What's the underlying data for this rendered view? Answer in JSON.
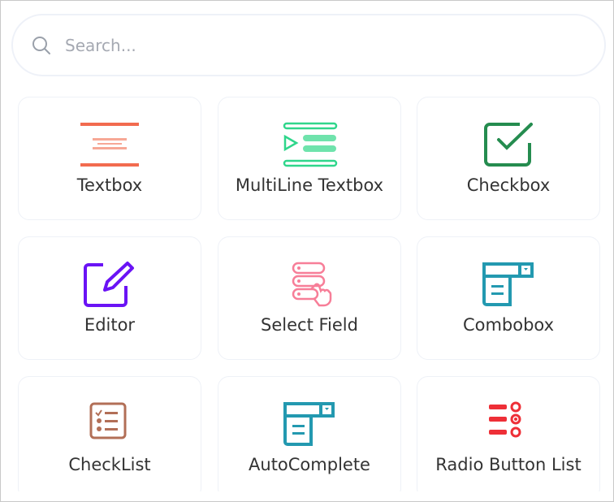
{
  "search": {
    "placeholder": "Search..."
  },
  "items": [
    {
      "label": "Textbox",
      "icon": "textbox-icon",
      "color": "#f26b4f"
    },
    {
      "label": "MultiLine Textbox",
      "icon": "multiline-textbox-icon",
      "color": "#2fd68b"
    },
    {
      "label": "Checkbox",
      "icon": "checkbox-icon",
      "color": "#258c4f"
    },
    {
      "label": "Editor",
      "icon": "editor-icon",
      "color": "#6a13f5"
    },
    {
      "label": "Select Field",
      "icon": "select-field-icon",
      "color": "#f77e98"
    },
    {
      "label": "Combobox",
      "icon": "combobox-icon",
      "color": "#2399b0"
    },
    {
      "label": "CheckList",
      "icon": "checklist-icon",
      "color": "#b26f57"
    },
    {
      "label": "AutoComplete",
      "icon": "autocomplete-icon",
      "color": "#2399b0"
    },
    {
      "label": "Radio Button List",
      "icon": "radio-button-list-icon",
      "color": "#ee2f37"
    }
  ]
}
